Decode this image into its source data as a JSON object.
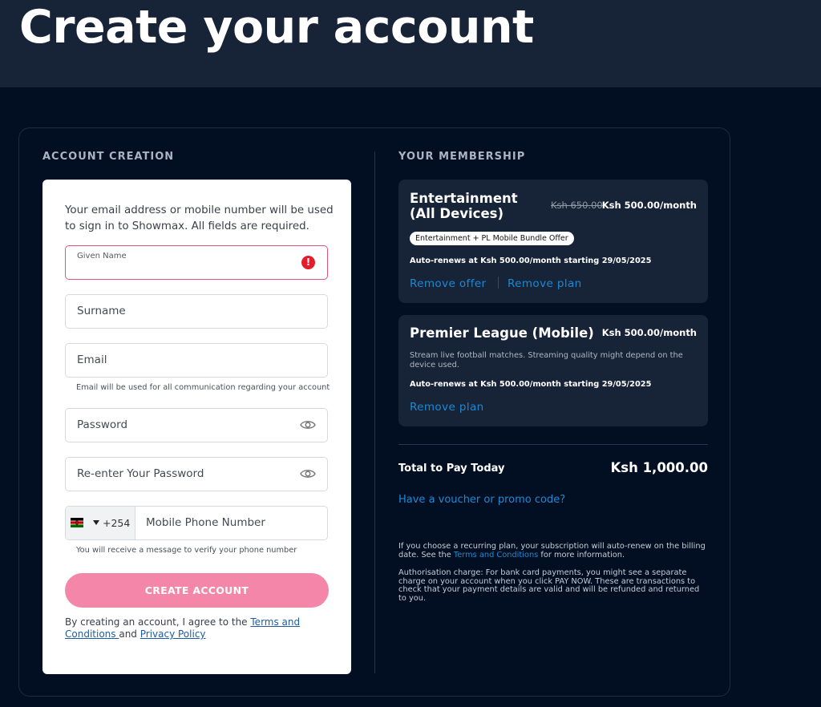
{
  "page": {
    "title": "Create your account"
  },
  "account_section": {
    "heading": "ACCOUNT CREATION",
    "intro": "Your email address or mobile number will be used to sign in to Showmax. All fields are required.",
    "fields": {
      "given_name": "Given Name",
      "surname": "Surname",
      "email": "Email",
      "email_hint": "Email will be used for all communication regarding your account",
      "password": "Password",
      "reenter_password": "Re-enter Your Password",
      "country_code": "+254",
      "mobile": "Mobile Phone Number",
      "mobile_hint": "You will receive a message to verify your phone number"
    },
    "create_button": "CREATE ACCOUNT",
    "terms": {
      "prefix": "By creating an account, I agree to the ",
      "terms_link": "Terms and Conditions ",
      "and": "and ",
      "privacy_link": "Privacy Policy"
    }
  },
  "membership": {
    "heading": "YOUR MEMBERSHIP",
    "plans": [
      {
        "name": "Entertainment (All Devices)",
        "old_price": "Ksh 650.00",
        "price": "Ksh 500.00/month",
        "badge": "Entertainment + PL Mobile Bundle Offer",
        "renew": "Auto-renews at Ksh 500.00/month starting 29/05/2025",
        "remove_offer": "Remove offer",
        "remove_plan": "Remove plan"
      },
      {
        "name": "Premier League (Mobile)",
        "price": "Ksh 500.00/month",
        "description": "Stream live football matches. Streaming quality might depend on the device used.",
        "renew": "Auto-renews at Ksh 500.00/month starting 29/05/2025",
        "remove_plan": "Remove plan"
      }
    ],
    "total_label": "Total to Pay Today",
    "total_amount": "Ksh 1,000.00",
    "voucher": "Have a voucher or promo code?",
    "recurring_note": {
      "prefix": "If you choose a recurring plan, your subscription will auto-renew on the billing date. See the ",
      "link": "Terms and Conditions",
      "suffix": " for more information."
    },
    "authorisation_note": "Authorisation charge: For bank card payments, you might see a separate charge on your account when you click PAY NOW. These are transactions to check that your payment details are valid and will be refunded and returned to you."
  },
  "colors": {
    "page_background": "#020f22",
    "header_background": "#172336",
    "card_background": "#172336",
    "accent_link": "#1b8ad6",
    "button_pink": "#f487a9",
    "error_red": "#e41c2c"
  },
  "icons": [
    "error-icon",
    "eye-icon",
    "kenya-flag-icon",
    "caret-down-icon"
  ]
}
